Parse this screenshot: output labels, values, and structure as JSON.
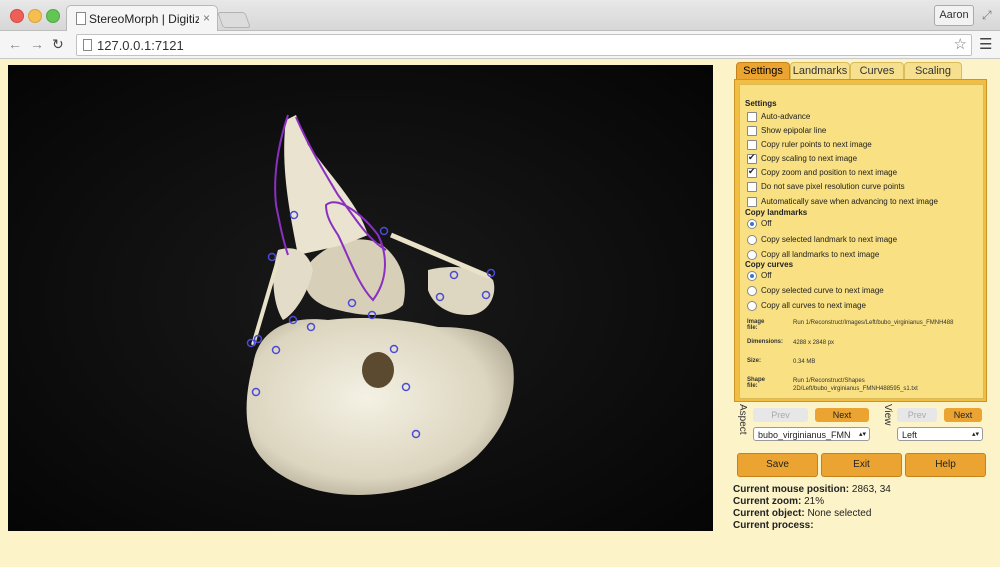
{
  "browser": {
    "tab_title": "StereoMorph | Digitizing A",
    "tab_close": "×",
    "user_button": "Aaron",
    "url": "127.0.0.1:7121",
    "nav_back_icon": "arrow-left-icon",
    "nav_forward_icon": "arrow-right-icon",
    "reload_icon": "reload-icon",
    "star_icon": "star-icon",
    "menu_icon": "hamburger-menu-icon"
  },
  "tabs": [
    {
      "label": "Settings",
      "active": true
    },
    {
      "label": "Landmarks",
      "active": false
    },
    {
      "label": "Curves",
      "active": false
    },
    {
      "label": "Scaling",
      "active": false
    }
  ],
  "settings": {
    "section_title": "Settings",
    "checkboxes": [
      {
        "label": "Auto-advance",
        "checked": false
      },
      {
        "label": "Show epipolar line",
        "checked": false
      },
      {
        "label": "Copy ruler points to next image",
        "checked": false
      },
      {
        "label": "Copy scaling to next image",
        "checked": true
      },
      {
        "label": "Copy zoom and position to next image",
        "checked": true
      },
      {
        "label": "Do not save pixel resolution curve points",
        "checked": false
      },
      {
        "label": "Automatically save when advancing to next image",
        "checked": false
      }
    ],
    "landmarks_title": "Copy landmarks",
    "landmark_options": [
      {
        "label": "Off",
        "selected": true
      },
      {
        "label": "Copy selected landmark to next image",
        "selected": false
      },
      {
        "label": "Copy all landmarks to next image",
        "selected": false
      }
    ],
    "curves_title": "Copy curves",
    "curve_options": [
      {
        "label": "Off",
        "selected": true
      },
      {
        "label": "Copy selected curve to next image",
        "selected": false
      },
      {
        "label": "Copy all curves to next image",
        "selected": false
      }
    ],
    "info": [
      {
        "key": "Image file:",
        "value": "Run 1/Reconstruct/Images/Left/bubo_virginianus_FMNH488"
      },
      {
        "key": "Dimensions:",
        "value": "4288 x 2848 px"
      },
      {
        "key": "Size:",
        "value": "0.34 MB"
      },
      {
        "key": "Shape file:",
        "value": "Run 1/Reconstruct/Shapes 2D/Left/bubo_virginianus_FMNH488595_s1.txt"
      }
    ]
  },
  "aspect": {
    "label": "Aspect",
    "prev": "Prev",
    "next": "Next",
    "selected": "bubo_virginianus_FMN"
  },
  "view": {
    "label": "View",
    "prev": "Prev",
    "next": "Next",
    "selected": "Left"
  },
  "actions": {
    "save": "Save",
    "exit": "Exit",
    "help": "Help"
  },
  "status": {
    "mouse_label": "Current mouse position:",
    "mouse_value": "2863, 34",
    "zoom_label": "Current zoom:",
    "zoom_value": "21%",
    "object_label": "Current object:",
    "object_value": "None selected",
    "process_label": "Current process:",
    "process_value": ""
  },
  "colors": {
    "accent": "#eba431",
    "panel_bg": "#f8e083",
    "page_bg": "#fcf3c9",
    "landmark": "#4b4bd8",
    "curve": "#8a2fc0"
  }
}
